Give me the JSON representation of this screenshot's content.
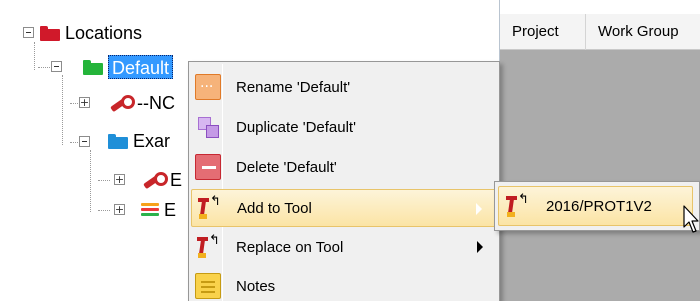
{
  "tree": {
    "items": [
      {
        "label": "Locations",
        "icon": "red-folder-icon"
      },
      {
        "label": "Default",
        "icon": "green-folder-icon",
        "visible_text": "Default"
      },
      {
        "label": "--NC",
        "icon": "wrench-icon"
      },
      {
        "label": "Exar",
        "icon": "blue-folder-icon"
      },
      {
        "label": "E",
        "icon": "wrench-icon"
      },
      {
        "label": "E",
        "icon": "layers-icon"
      }
    ]
  },
  "grid": {
    "columns": [
      "Project",
      "Work Group"
    ]
  },
  "context_menu": {
    "items": [
      {
        "label": "Rename 'Default'",
        "icon": "rename-icon"
      },
      {
        "label": "Duplicate 'Default'",
        "icon": "duplicate-icon"
      },
      {
        "label": "Delete 'Default'",
        "icon": "delete-icon"
      },
      {
        "label": "Add to Tool",
        "icon": "tool-icon",
        "highlighted": true,
        "has_submenu": true
      },
      {
        "label": "Replace on Tool",
        "icon": "tool-icon",
        "has_submenu": true
      },
      {
        "label": "Notes",
        "icon": "notes-icon"
      }
    ]
  },
  "submenu": {
    "items": [
      {
        "label": "2016/PROT1V2",
        "icon": "tool-icon"
      }
    ]
  },
  "colors": {
    "selection": "#3399ff",
    "menu_highlight": "#fbe4a5",
    "menu_bg": "#f0f0f0",
    "grid_bg": "#ababab"
  }
}
